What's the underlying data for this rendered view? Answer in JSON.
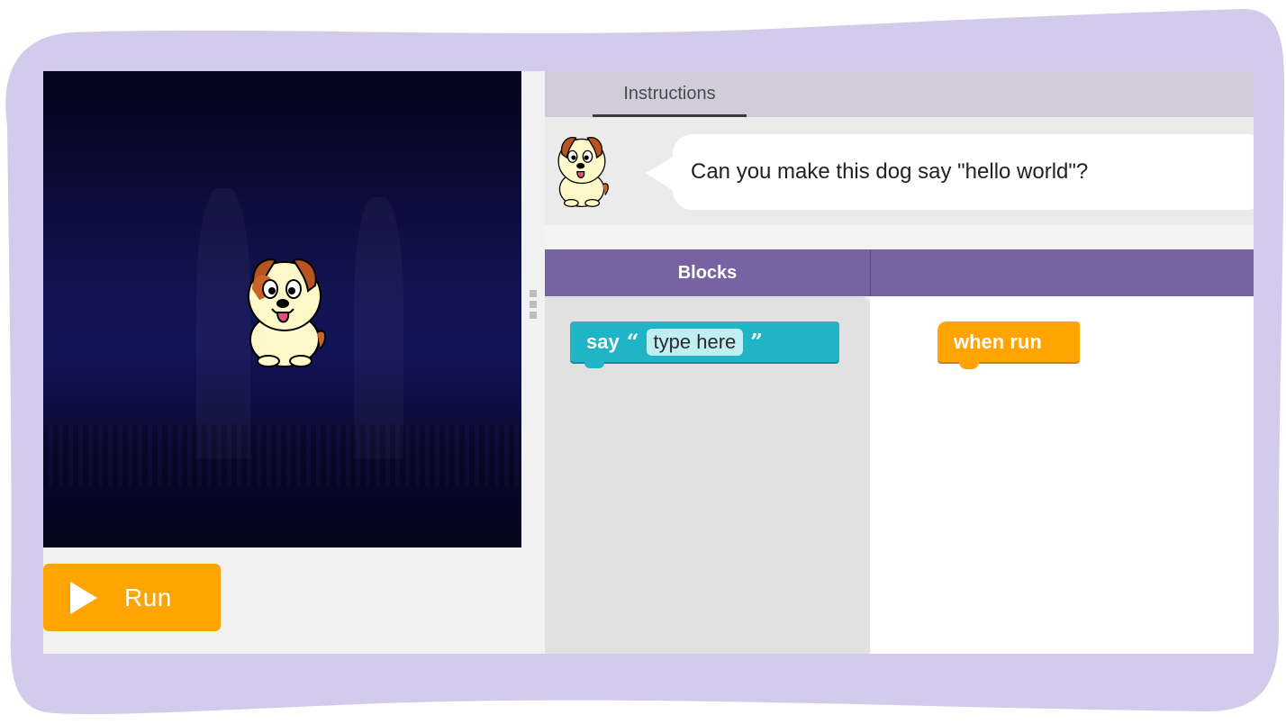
{
  "instructions": {
    "tab_label": "Instructions",
    "prompt": "Can you make this dog say \"hello world\"?"
  },
  "run": {
    "label": "Run"
  },
  "blocks": {
    "header": "Blocks",
    "toolbox": {
      "say_block": {
        "keyword": "say",
        "open_quote": "“",
        "placeholder": "type here",
        "close_quote": "”"
      }
    },
    "workspace": {
      "when_run_block": {
        "label": "when run"
      }
    }
  },
  "colors": {
    "frame": "#d2cbeb",
    "run_button": "#ffa400",
    "blocks_header": "#7763a2",
    "say_block": "#1fb5c6",
    "event_block": "#ffa400",
    "stage_bg": "#12134f"
  },
  "icons": {
    "run": "play-icon",
    "character": "dog-sprite",
    "splitter": "drag-handle-icon"
  }
}
